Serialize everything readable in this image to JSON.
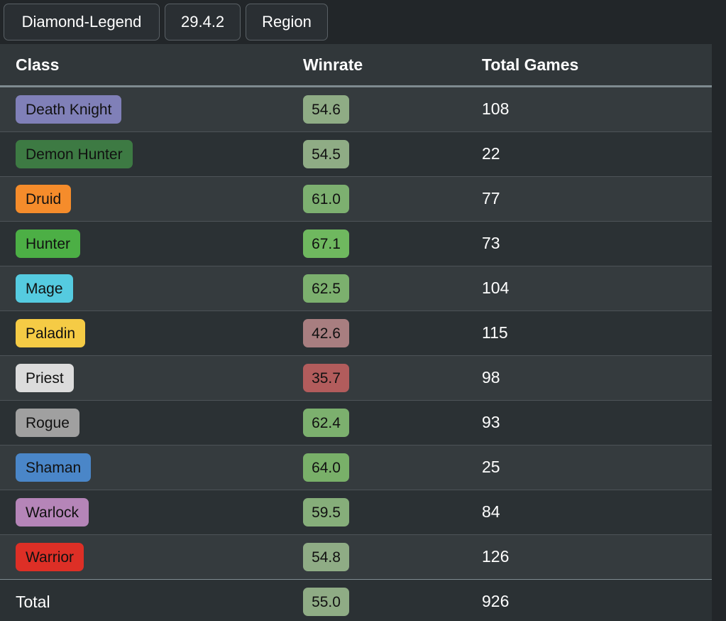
{
  "theme": {
    "page_bg": "#222629",
    "table_bg": "#31373a",
    "row_odd_bg": "#353b3e",
    "row_even_bg": "#2b3134",
    "row_divider": "#4d5357",
    "header_underline": "#7f8b90",
    "text_primary": "#ffffff",
    "pill_text": "#111111",
    "button_border": "#5a6166",
    "button_bg": "#2a2f33"
  },
  "filters": [
    {
      "id": "rank-filter",
      "label": "Diamond-Legend",
      "wide": true
    },
    {
      "id": "patch-filter",
      "label": "29.4.2",
      "wide": false
    },
    {
      "id": "region-filter",
      "label": "Region",
      "wide": false
    }
  ],
  "table": {
    "columns": [
      {
        "key": "class",
        "label": "Class"
      },
      {
        "key": "winrate",
        "label": "Winrate"
      },
      {
        "key": "games",
        "label": "Total Games"
      }
    ],
    "rows": [
      {
        "class": "Death Knight",
        "winrate": "54.6",
        "games": "108",
        "class_color": "#8080b8",
        "win_color": "#8fac85"
      },
      {
        "class": "Demon Hunter",
        "winrate": "54.5",
        "games": "22",
        "class_color": "#3d7a43",
        "win_color": "#8fac85"
      },
      {
        "class": "Druid",
        "winrate": "61.0",
        "games": "77",
        "class_color": "#f58c2b",
        "win_color": "#7db070"
      },
      {
        "class": "Hunter",
        "winrate": "67.1",
        "games": "73",
        "class_color": "#4caf45",
        "win_color": "#6fb85f"
      },
      {
        "class": "Mage",
        "winrate": "62.5",
        "games": "104",
        "class_color": "#55cbe0",
        "win_color": "#7cb06e"
      },
      {
        "class": "Paladin",
        "winrate": "42.6",
        "games": "115",
        "class_color": "#f5cb45",
        "win_color": "#a87e80"
      },
      {
        "class": "Priest",
        "winrate": "35.7",
        "games": "98",
        "class_color": "#dcdcdc",
        "win_color": "#b25c5c"
      },
      {
        "class": "Rogue",
        "winrate": "62.4",
        "games": "93",
        "class_color": "#a0a0a0",
        "win_color": "#7cb06e"
      },
      {
        "class": "Shaman",
        "winrate": "64.0",
        "games": "25",
        "class_color": "#4a86c8",
        "win_color": "#79b069"
      },
      {
        "class": "Warlock",
        "winrate": "59.5",
        "games": "84",
        "class_color": "#b585b8",
        "win_color": "#86ae7a"
      },
      {
        "class": "Warrior",
        "winrate": "54.8",
        "games": "126",
        "class_color": "#dd2f26",
        "win_color": "#8fac85"
      }
    ],
    "total": {
      "label": "Total",
      "winrate": "55.0",
      "games": "926",
      "win_color": "#8fac85"
    }
  },
  "chart_data": {
    "type": "table",
    "title": "Class Winrate by Total Games",
    "categories": [
      "Death Knight",
      "Demon Hunter",
      "Druid",
      "Hunter",
      "Mage",
      "Paladin",
      "Priest",
      "Rogue",
      "Shaman",
      "Warlock",
      "Warrior"
    ],
    "series": [
      {
        "name": "Winrate",
        "values": [
          54.6,
          54.5,
          61.0,
          67.1,
          62.5,
          42.6,
          35.7,
          62.4,
          64.0,
          59.5,
          54.8
        ]
      },
      {
        "name": "Total Games",
        "values": [
          108,
          22,
          77,
          73,
          104,
          115,
          98,
          93,
          25,
          84,
          126
        ]
      }
    ],
    "totals": {
      "Winrate": 55.0,
      "Total Games": 926
    },
    "xlabel": "Class",
    "ylabel": "Winrate",
    "filters": {
      "rank": "Diamond-Legend",
      "patch": "29.4.2",
      "region": "Region"
    }
  }
}
